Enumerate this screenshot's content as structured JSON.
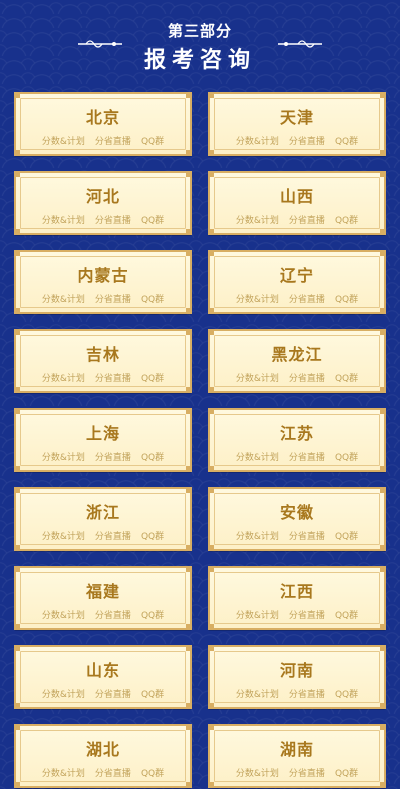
{
  "header": {
    "part_label": "第三部分",
    "title": "报考咨询"
  },
  "link_labels": {
    "score_plan": "分数&计划",
    "live": "分省直播",
    "qq": "QQ群"
  },
  "provinces": [
    "北京",
    "天津",
    "河北",
    "山西",
    "内蒙古",
    "辽宁",
    "吉林",
    "黑龙江",
    "上海",
    "江苏",
    "浙江",
    "安徽",
    "福建",
    "江西",
    "山东",
    "河南",
    "湖北",
    "湖南"
  ],
  "colors": {
    "background": "#18318c",
    "card_border": "#d8ae63",
    "card_fill": "#fff9df",
    "name_text": "#a8781e",
    "link_text": "#c2a35b"
  }
}
